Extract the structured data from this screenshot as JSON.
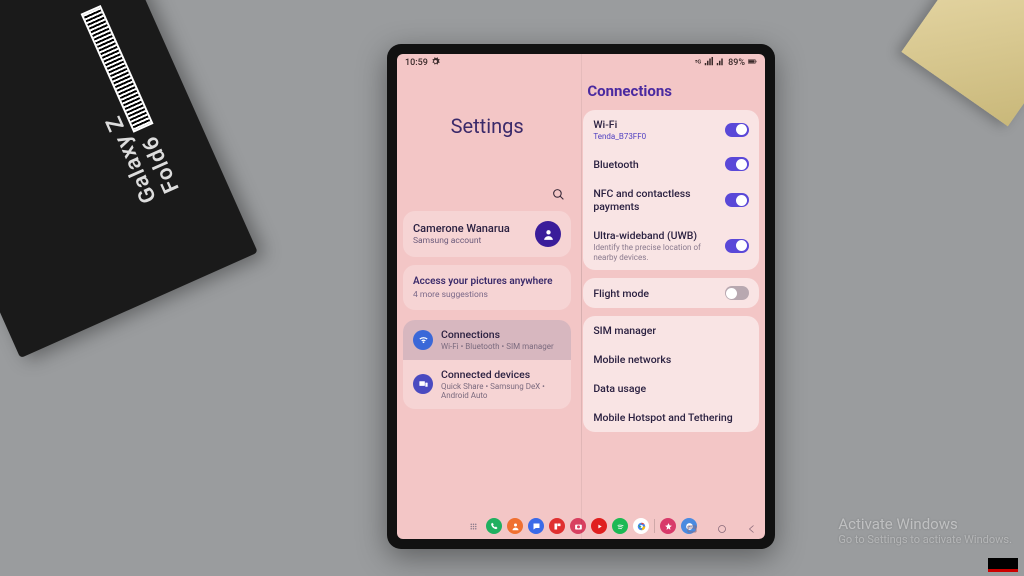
{
  "status_bar": {
    "time": "10:59",
    "battery": "89%"
  },
  "left_pane": {
    "title": "Settings",
    "account": {
      "name": "Camerone Wanarua",
      "sub": "Samsung account"
    },
    "suggestion": {
      "title": "Access your pictures anywhere",
      "sub": "4 more suggestions"
    },
    "items": [
      {
        "title": "Connections",
        "sub": "Wi-Fi • Bluetooth • SIM manager",
        "icon": "wifi",
        "color": "#3a68d8",
        "selected": true
      },
      {
        "title": "Connected devices",
        "sub": "Quick Share • Samsung DeX • Android Auto",
        "icon": "devices",
        "color": "#4a4ac0",
        "selected": false
      }
    ]
  },
  "right_pane": {
    "header": "Connections",
    "group1": [
      {
        "title": "Wi-Fi",
        "sub": "Tenda_B73FF0",
        "toggle": "on"
      },
      {
        "title": "Bluetooth",
        "toggle": "on"
      },
      {
        "title": "NFC and contactless payments",
        "toggle": "on"
      },
      {
        "title": "Ultra-wideband (UWB)",
        "desc": "Identify the precise location of nearby devices.",
        "toggle": "on"
      }
    ],
    "group2": [
      {
        "title": "Flight mode",
        "toggle": "off"
      }
    ],
    "group3": [
      {
        "title": "SIM manager"
      },
      {
        "title": "Mobile networks"
      },
      {
        "title": "Data usage"
      },
      {
        "title": "Mobile Hotspot and Tethering"
      }
    ]
  },
  "dock": {
    "apps": [
      {
        "name": "apps",
        "color": "#8a7a8a"
      },
      {
        "name": "phone",
        "color": "#20b060"
      },
      {
        "name": "contacts",
        "color": "#f07030"
      },
      {
        "name": "messages",
        "color": "#3a6ae8"
      },
      {
        "name": "flipboard",
        "color": "#e03030"
      },
      {
        "name": "camera",
        "color": "#d84060"
      },
      {
        "name": "youtube",
        "color": "#e02020"
      },
      {
        "name": "spotify",
        "color": "#1db954"
      },
      {
        "name": "chrome",
        "color": "#ffffff"
      },
      {
        "name": "gallery",
        "color": "#d83a6a"
      },
      {
        "name": "chat",
        "color": "#4a8ae0"
      }
    ]
  },
  "watermark": {
    "title": "Activate Windows",
    "sub": "Go to Settings to activate Windows."
  },
  "box_label": "Galaxy Z Fold6"
}
